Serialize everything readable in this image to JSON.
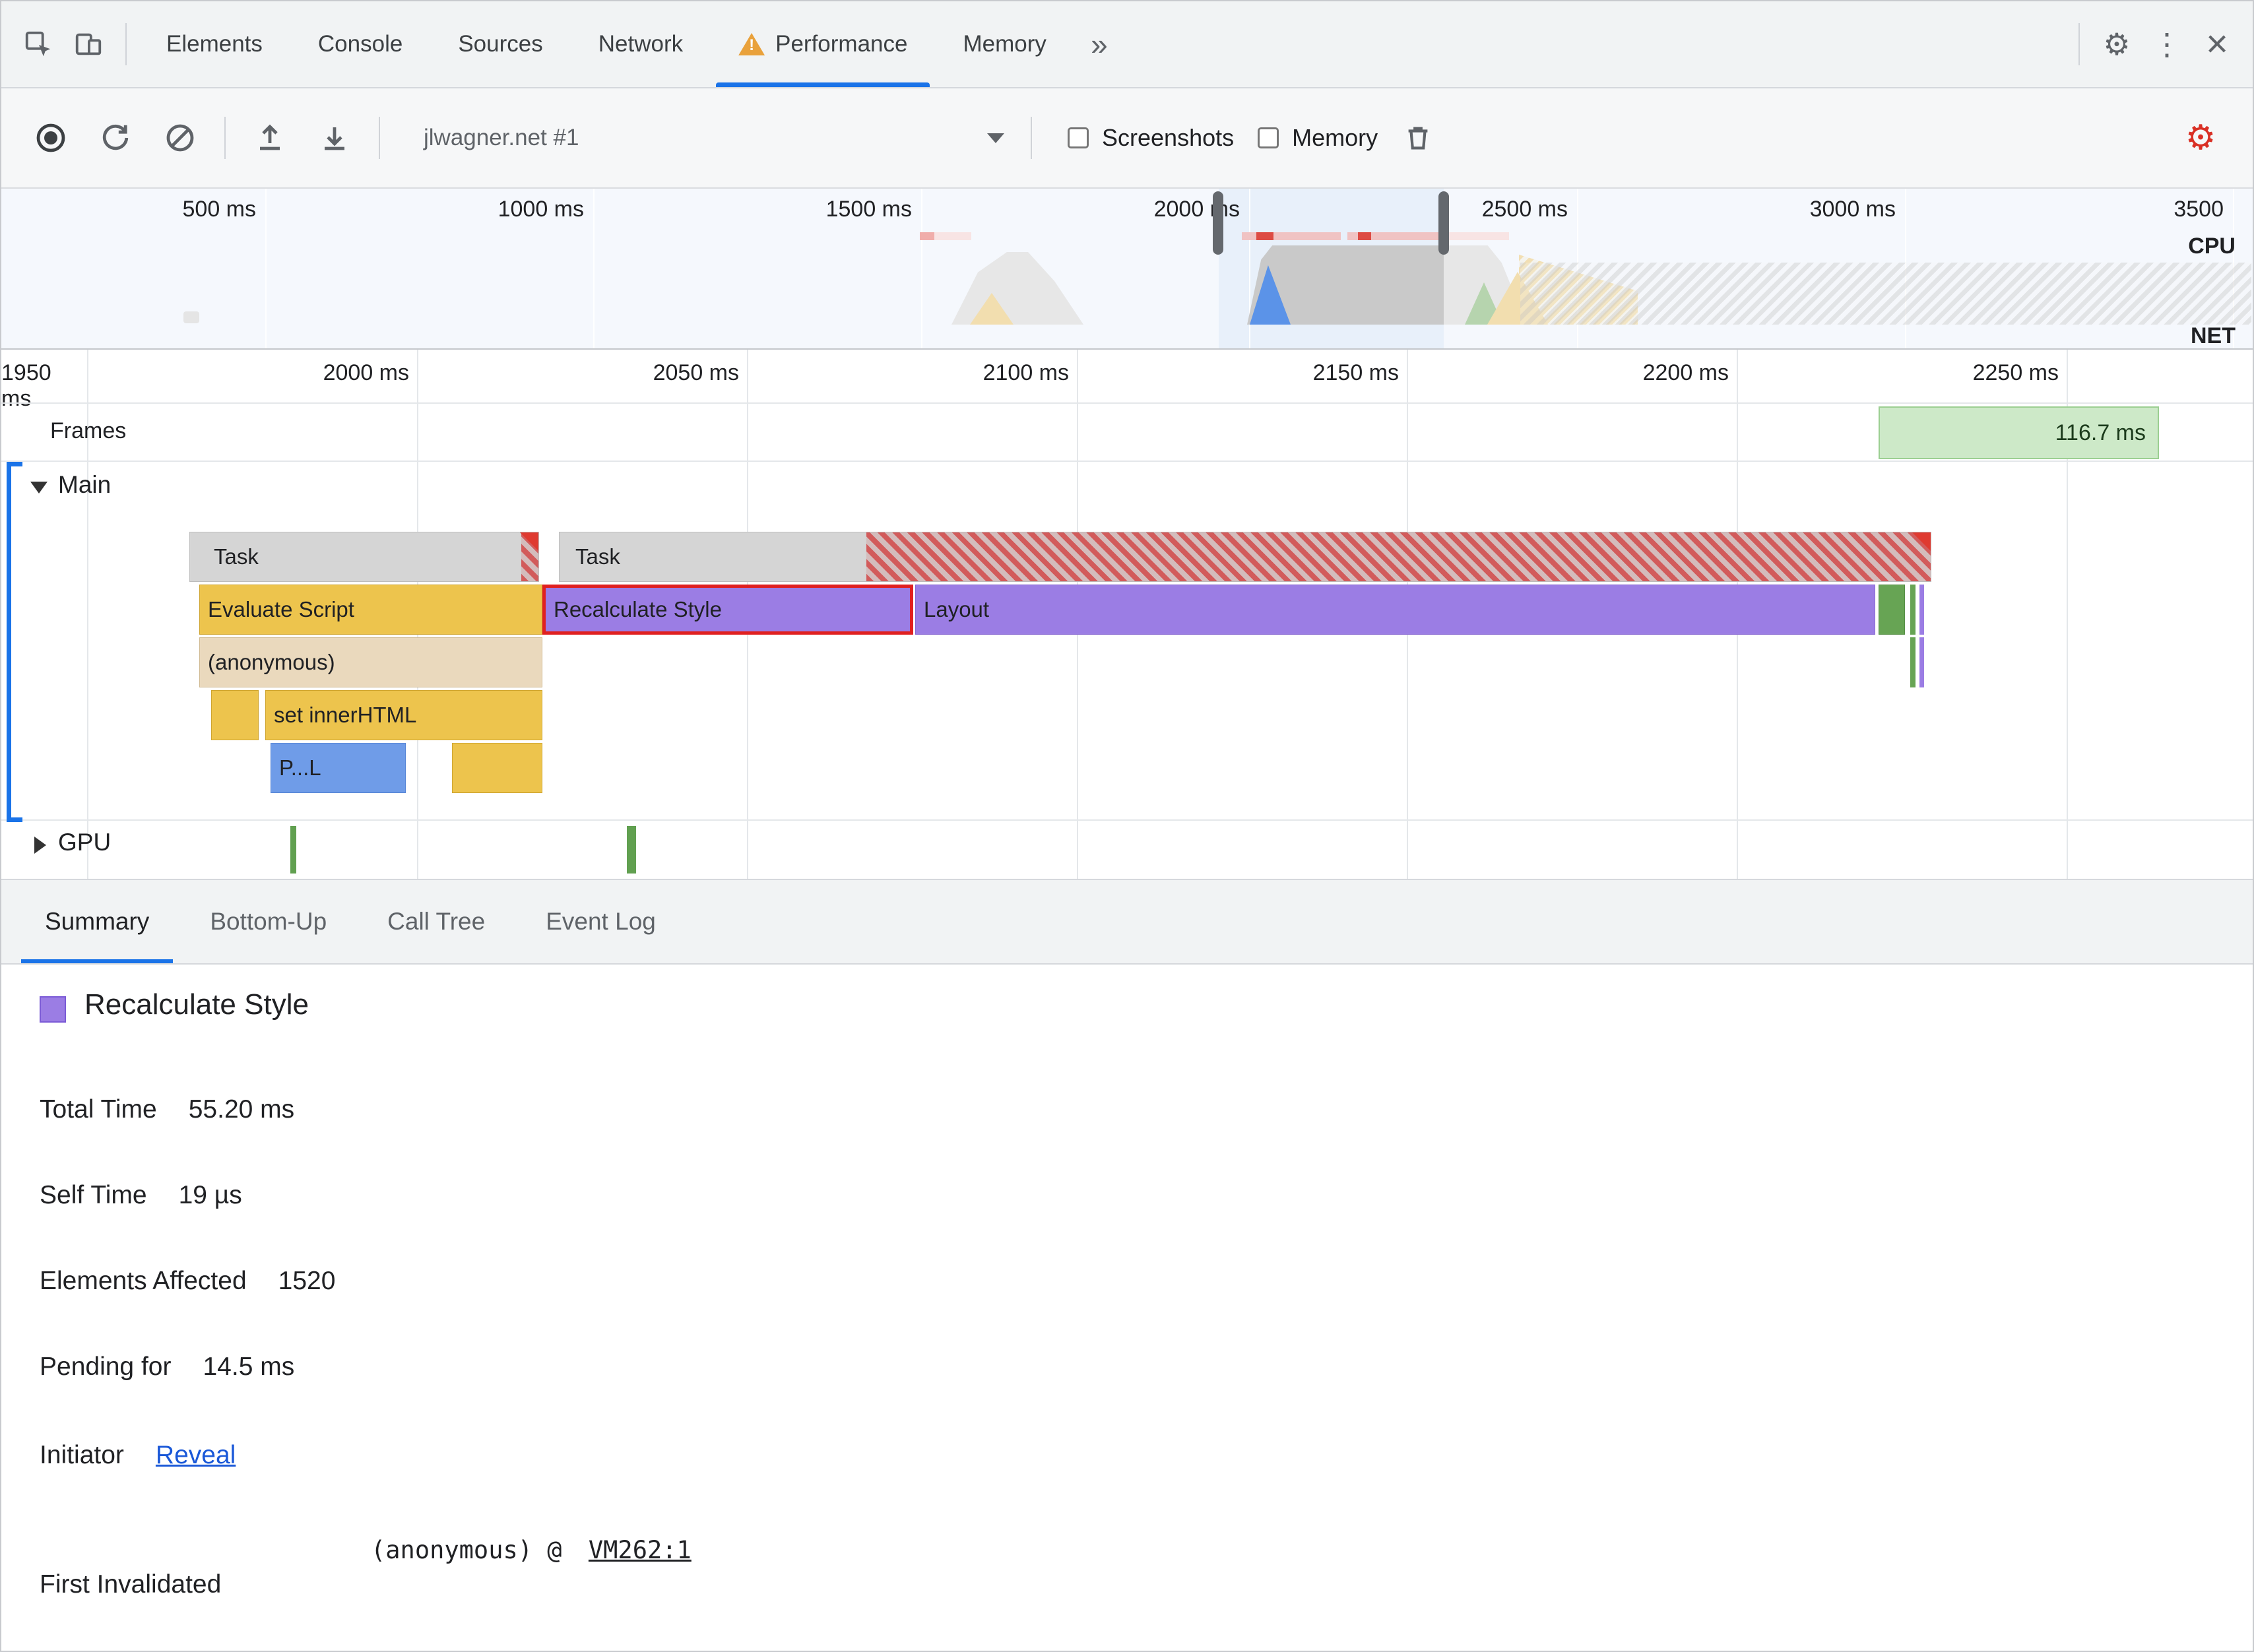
{
  "colors": {
    "accent_blue": "#1a73e8",
    "warning_orange": "#e9a13b",
    "task_gray": "#d5d5d5",
    "script_yellow": "#edc44d",
    "style_purple": "#9b7de4",
    "paint_green": "#67a454",
    "parse_blue": "#6f9ce8",
    "function_tan": "#ead9bd",
    "long_task_red": "#df3a30",
    "selection_red": "#e02020",
    "link_blue": "#1a58d8",
    "frame_green": "#cde9c8"
  },
  "devtools_tabbar": {
    "tabs": [
      "Elements",
      "Console",
      "Sources",
      "Network",
      "Performance",
      "Memory"
    ],
    "active_tab": "Performance",
    "warning_glyph": "!",
    "more_tabs_glyph": "»",
    "gear_glyph": "⚙",
    "kebab_glyph": "⋮",
    "close_glyph": "×"
  },
  "perf_toolbar": {
    "profile_name": "jlwagner.net #1",
    "screenshots_label": "Screenshots",
    "screenshots_checked": false,
    "memory_label": "Memory",
    "memory_checked": false,
    "settings_gear_glyph": "⚙"
  },
  "overview": {
    "ticks": [
      "500 ms",
      "1000 ms",
      "1500 ms",
      "2000 ms",
      "2500 ms",
      "3000 ms",
      "3500"
    ],
    "cpu_label": "CPU",
    "net_label": "NET"
  },
  "timeline": {
    "ticks": [
      "1950 ms",
      "2000 ms",
      "2050 ms",
      "2100 ms",
      "2150 ms",
      "2200 ms",
      "2250 ms"
    ],
    "frames_label": "Frames",
    "frame_duration": "116.7 ms",
    "main_label": "Main",
    "gpu_label": "GPU",
    "events": {
      "task1": "Task",
      "task2": "Task",
      "evaluate_script": "Evaluate Script",
      "recalculate_style": "Recalculate Style",
      "layout": "Layout",
      "anonymous_fn": "(anonymous)",
      "set_inner_html": "set innerHTML",
      "parse_html": "P...L"
    }
  },
  "bottom_tabbar": {
    "tabs": [
      "Summary",
      "Bottom-Up",
      "Call Tree",
      "Event Log"
    ],
    "active_tab": "Summary"
  },
  "summary": {
    "title": "Recalculate Style",
    "rows": [
      {
        "label": "Total Time",
        "value": "55.20 ms"
      },
      {
        "label": "Self Time",
        "value": "19 µs"
      },
      {
        "label": "Elements Affected",
        "value": "1520"
      },
      {
        "label": "Pending for",
        "value": "14.5 ms"
      }
    ],
    "initiator_label": "Initiator",
    "initiator_link": "Reveal",
    "first_invalidated_label": "First Invalidated",
    "first_invalidated_prefix": "(anonymous) @",
    "first_invalidated_link": "VM262:1"
  }
}
